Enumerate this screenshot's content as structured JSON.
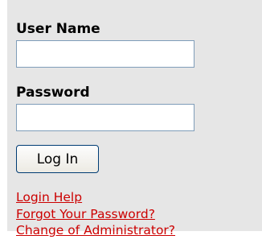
{
  "login_form": {
    "username_label": "User Name",
    "username_value": "",
    "password_label": "Password",
    "password_value": "",
    "login_button_label": "Log In"
  },
  "links": {
    "login_help": "Login Help",
    "forgot_password": "Forgot Your Password?",
    "change_admin": "Change of Administrator?"
  },
  "colors": {
    "panel_background": "#e6e6e6",
    "link": "#cc0000",
    "input_border": "#7f9db9"
  }
}
